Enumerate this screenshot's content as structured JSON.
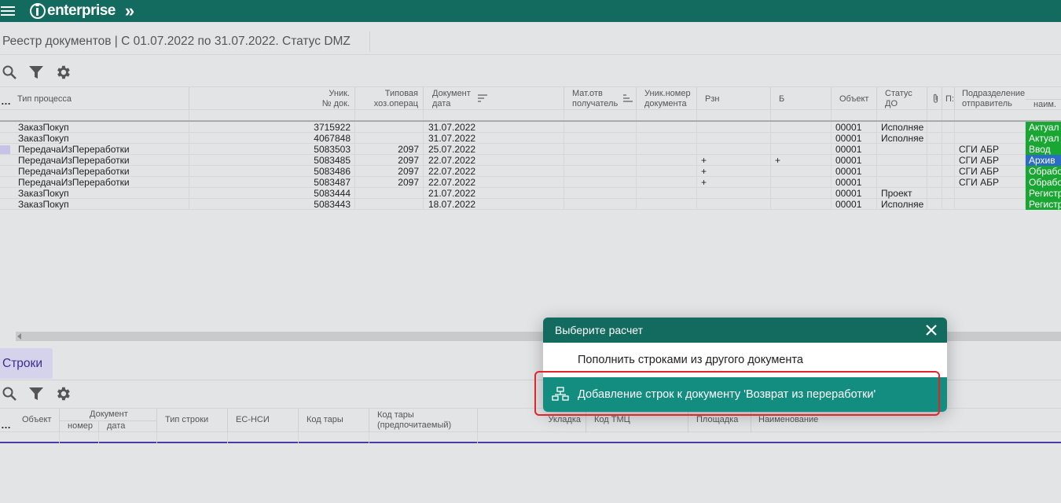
{
  "header": {
    "logo_text": "enterprise",
    "expand_glyph": "»",
    "bg_color": "#136a5f"
  },
  "page": {
    "title": "Реестр документов | С 01.07.2022 по 31.07.2022. Статус DMZ"
  },
  "toolbar": {
    "icons": [
      "search-icon",
      "filter-icon",
      "gear-icon"
    ]
  },
  "main_grid": {
    "columns": [
      {
        "key": "proc",
        "label": "Тип процесса"
      },
      {
        "key": "num",
        "label_l1": "Уник.",
        "label_l2": "№ док."
      },
      {
        "key": "op",
        "label_l1": "Типовая",
        "label_l2": "хоз.операц"
      },
      {
        "key": "date",
        "label_l1": "Документ",
        "label_l2": "дата"
      },
      {
        "key": "mat",
        "label_l1": "Мат.отв",
        "label_l2": "получатель"
      },
      {
        "key": "unum",
        "label_l1": "Уник.номер",
        "label_l2": "документа"
      },
      {
        "key": "rzn",
        "label": "Рзн"
      },
      {
        "key": "b",
        "label": "Б"
      },
      {
        "key": "obj",
        "label": "Объект"
      },
      {
        "key": "st",
        "label_l1": "Статус",
        "label_l2": "ДО"
      },
      {
        "key": "p",
        "label": "П:"
      },
      {
        "key": "dep",
        "label_l1": "Подразделение",
        "label_l2": "отправитель"
      },
      {
        "key": "name",
        "label": "наим."
      }
    ],
    "rows": [
      {
        "proc": "ЗаказПокуп",
        "num": "3715922",
        "op": "",
        "date": "31.07.2022",
        "rzn": "",
        "b": "",
        "obj": "00001",
        "st": "Исполняе",
        "dep": "",
        "status": "Актуал",
        "status_color": "#1aa632"
      },
      {
        "proc": "ЗаказПокуп",
        "num": "4067848",
        "op": "",
        "date": "31.07.2022",
        "rzn": "",
        "b": "",
        "obj": "00001",
        "st": "Исполняе",
        "dep": "",
        "status": "Актуал",
        "status_color": "#1aa632"
      },
      {
        "proc": "ПередачаИзПереработки",
        "num": "5083503",
        "op": "2097",
        "date": "25.07.2022",
        "rzn": "",
        "b": "",
        "obj": "00001",
        "st": "",
        "dep": "СГИ АБР",
        "status": "Ввод",
        "status_color": "#1aa632"
      },
      {
        "proc": "ПередачаИзПереработки",
        "num": "5083485",
        "op": "2097",
        "date": "22.07.2022",
        "rzn": "+",
        "b": "+",
        "obj": "00001",
        "st": "",
        "dep": "СГИ АБР",
        "status": "Архив",
        "status_color": "#2b6cc4"
      },
      {
        "proc": "ПередачаИзПереработки",
        "num": "5083486",
        "op": "2097",
        "date": "22.07.2022",
        "rzn": "+",
        "b": "",
        "obj": "00001",
        "st": "",
        "dep": "СГИ АБР",
        "status": "Обрабо",
        "status_color": "#1aa632"
      },
      {
        "proc": "ПередачаИзПереработки",
        "num": "5083487",
        "op": "2097",
        "date": "22.07.2022",
        "rzn": "+",
        "b": "",
        "obj": "00001",
        "st": "",
        "dep": "СГИ АБР",
        "status": "Обрабо",
        "status_color": "#1aa632"
      },
      {
        "proc": "ЗаказПокуп",
        "num": "5083444",
        "op": "",
        "date": "21.07.2022",
        "rzn": "",
        "b": "",
        "obj": "00001",
        "st": "Проект",
        "dep": "",
        "status": "Регистр",
        "status_color": "#1aa632"
      },
      {
        "proc": "ЗаказПокуп",
        "num": "5083443",
        "op": "",
        "date": "18.07.2022",
        "rzn": "",
        "b": "",
        "obj": "00001",
        "st": "Исполняе",
        "dep": "",
        "status": "Регистр",
        "status_color": "#1aa632"
      }
    ]
  },
  "tabs": {
    "lines_label": "Строки"
  },
  "lines_grid": {
    "h_obj": "Объект",
    "h_doc": "Документ",
    "h_doc_num": "номер",
    "h_doc_date": "дата",
    "h_type": "Тип строки",
    "h_es": "ЕС-НСИ",
    "h_tara": "Код тары",
    "h_tara_pref_l1": "Код тары",
    "h_tara_pref_l2": "(предпочитаемый)",
    "h_ukl": "Укладка",
    "h_tmc": "Код ТМЦ",
    "h_site": "Площадка",
    "h_name": "Наименование"
  },
  "dialog": {
    "title": "Выберите расчет",
    "item1": "Пополнить строками из другого документа",
    "item2": "Добавление строк к документу 'Возврат из переработки'",
    "accent": "#148d81"
  }
}
